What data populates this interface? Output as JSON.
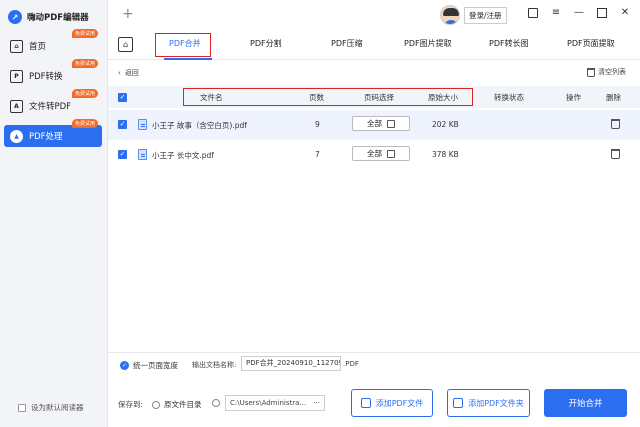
{
  "app": {
    "title": "嗨动PDF编辑器",
    "logo_icon": "app-logo-icon"
  },
  "sidebar": {
    "items": [
      {
        "label": "首页",
        "icon": "home-icon",
        "badge": "免费试用"
      },
      {
        "label": "PDF转换",
        "icon": "pdf-convert-icon",
        "badge": "免费试用"
      },
      {
        "label": "文件转PDF",
        "icon": "file-to-pdf-icon",
        "badge": "免费试用"
      },
      {
        "label": "PDF处理",
        "icon": "pdf-process-icon",
        "badge": "免费试用"
      }
    ],
    "default_reader": "设为默认阅读器"
  },
  "header": {
    "new_tab": "+",
    "login": "登录/注册"
  },
  "tabs": [
    "PDF合并",
    "PDF分割",
    "PDF压缩",
    "PDF图片提取",
    "PDF转长图",
    "PDF页面提取"
  ],
  "toolbar": {
    "back": "返回",
    "clear": "清空列表"
  },
  "table": {
    "headers": [
      "文件名",
      "页数",
      "页码选择",
      "原始大小",
      "转换状态",
      "操作",
      "删除"
    ],
    "rows": [
      {
        "name": "小王子 故事（含空白页).pdf",
        "pages": "9",
        "page_select": "全部",
        "size": "202 KB"
      },
      {
        "name": "小王子 长中文.pdf",
        "pages": "7",
        "page_select": "全部",
        "size": "378 KB"
      }
    ]
  },
  "footer": {
    "uniform_width": "统一页面宽度",
    "output_name_label": "输出文档名称:",
    "output_name_value": "PDF合并_20240910_112709",
    "output_ext": ".PDF",
    "save_to": "保存到:",
    "radio_source": "原文件目录",
    "path": "C:\\Users\\Administra...",
    "path_dots": "···",
    "add_pdf": "添加PDF文件",
    "add_folder": "添加PDF文件夹",
    "start": "开始合并"
  },
  "colors": {
    "accent": "#2b6ff0",
    "badge": "#f06c2b",
    "highlight": "#dd2222"
  }
}
